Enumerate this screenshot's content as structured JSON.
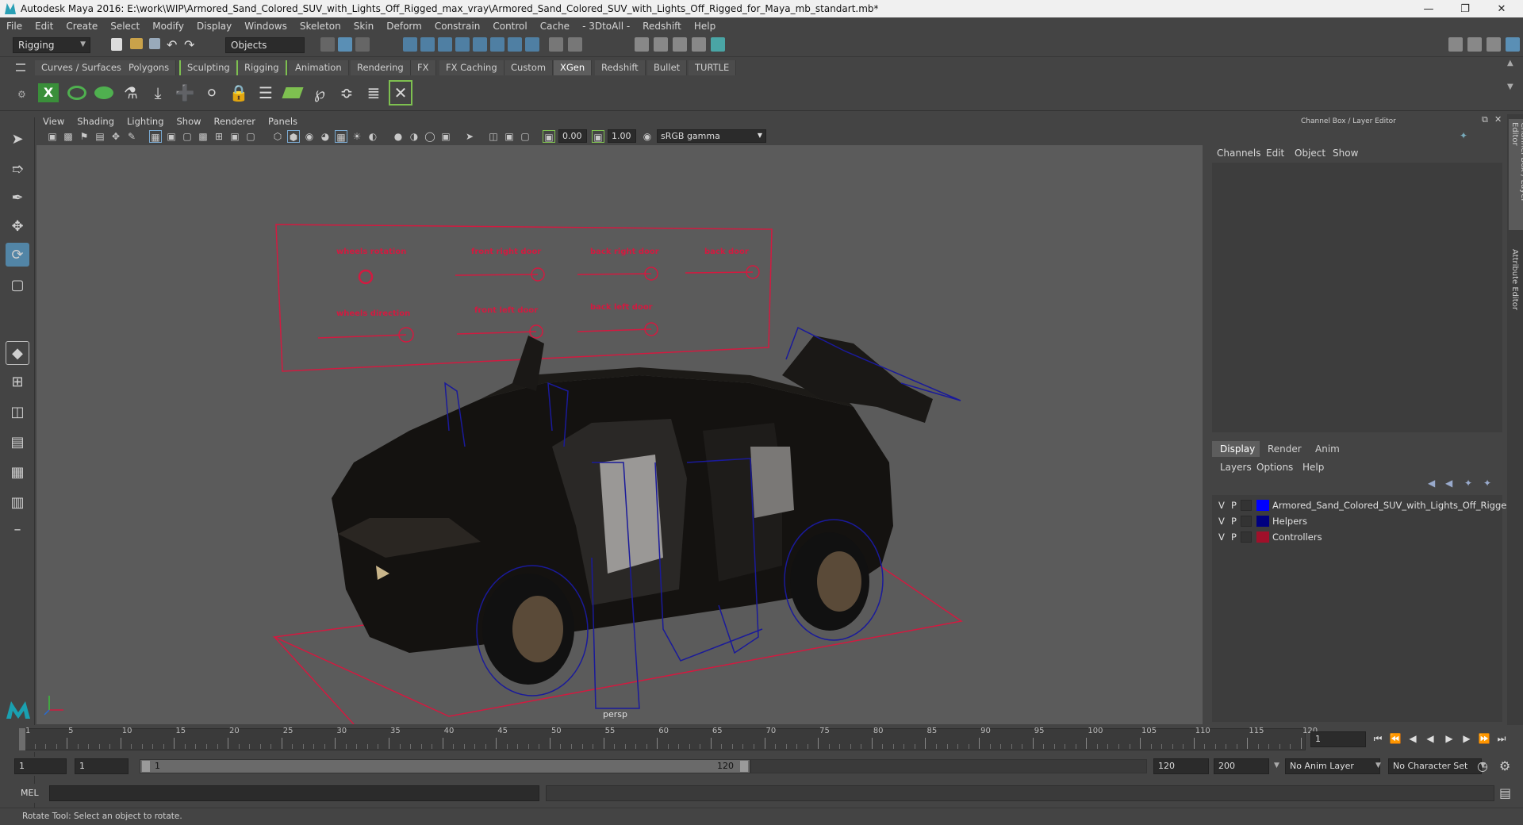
{
  "window": {
    "title": "Autodesk Maya 2016: E:\\work\\WIP\\Armored_Sand_Colored_SUV_with_Lights_Off_Rigged_max_vray\\Armored_Sand_Colored_SUV_with_Lights_Off_Rigged_for_Maya_mb_standart.mb*"
  },
  "menu": [
    "File",
    "Edit",
    "Create",
    "Select",
    "Modify",
    "Display",
    "Windows",
    "Skeleton",
    "Skin",
    "Deform",
    "Constrain",
    "Control",
    "Cache",
    "- 3DtoAll -",
    "Redshift",
    "Help"
  ],
  "status": {
    "mode": "Rigging",
    "selection_mode": "Objects"
  },
  "shelf_tabs": [
    "Curves / Surfaces",
    "Polygons",
    "Sculpting",
    "Rigging",
    "Animation",
    "Rendering",
    "FX",
    "FX Caching",
    "Custom",
    "XGen",
    "Redshift",
    "Bullet",
    "TURTLE"
  ],
  "shelf_active": "XGen",
  "panel_menu": [
    "View",
    "Shading",
    "Lighting",
    "Show",
    "Renderer",
    "Panels"
  ],
  "panel_tools": {
    "exposure": "0.00",
    "gamma": "1.00",
    "color_space": "sRGB gamma"
  },
  "viewport": {
    "camera": "persp",
    "controls": {
      "wheels_rotation": "wheels rotation",
      "front_right_door": "front right door",
      "back_right_door": "back right door",
      "back_door": "back door",
      "wheels_direction": "wheels direction",
      "front_left_door": "front left door",
      "back_left_door": "back  left door"
    }
  },
  "channel_box": {
    "title": "Channel Box / Layer Editor",
    "menu": [
      "Channels",
      "Edit",
      "Object",
      "Show"
    ]
  },
  "layer_editor": {
    "tabs": [
      "Display",
      "Render",
      "Anim"
    ],
    "active_tab": "Display",
    "menu": [
      "Layers",
      "Options",
      "Help"
    ],
    "layers": [
      {
        "v": "V",
        "p": "P",
        "name": "Armored_Sand_Colored_SUV_with_Lights_Off_Rigged",
        "color": "#0000ff"
      },
      {
        "v": "V",
        "p": "P",
        "name": "Helpers",
        "color": "#000080"
      },
      {
        "v": "V",
        "p": "P",
        "name": "Controllers",
        "color": "#a0102a"
      }
    ]
  },
  "side_tabs": [
    "Channel Box / Layer Editor",
    "Attribute Editor"
  ],
  "timeline": {
    "ticks": [
      "1",
      "5",
      "10",
      "15",
      "20",
      "25",
      "30",
      "35",
      "40",
      "45",
      "50",
      "55",
      "60",
      "65",
      "70",
      "75",
      "80",
      "85",
      "90",
      "95",
      "100",
      "105",
      "110",
      "115",
      "120"
    ],
    "current_frame": "1"
  },
  "range": {
    "start": "1",
    "playback_start": "1",
    "slider_start": "1",
    "slider_end": "120",
    "playback_end": "120",
    "end": "200",
    "anim_layer": "No Anim Layer",
    "character_set": "No Character Set"
  },
  "cmd": {
    "label": "MEL"
  },
  "help_line": "Rotate Tool: Select an object to rotate."
}
